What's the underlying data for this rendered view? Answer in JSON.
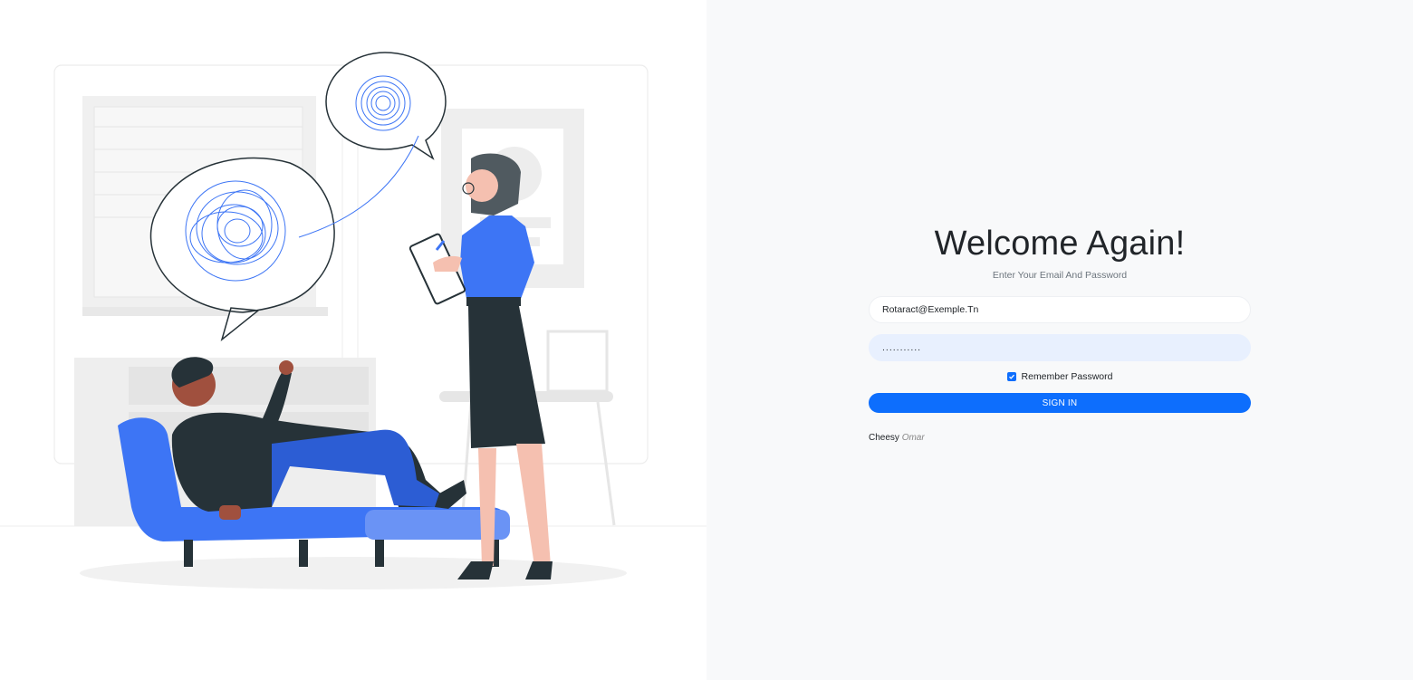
{
  "login": {
    "title": "Welcome Again!",
    "subtitle": "Enter Your Email And Password",
    "email_value": "Rotaract@Exemple.Tn",
    "password_value": "...........",
    "remember_label": "Remember Password",
    "remember_checked": true,
    "signin_label": "SIGN IN",
    "credit_first": "Cheesy",
    "credit_second": "Omar"
  },
  "colors": {
    "primary": "#0d6efd",
    "illustration_blue": "#3d75f5",
    "dark": "#263238",
    "right_bg": "#f8f9fa",
    "password_bg": "#e8f0fe"
  },
  "illustration": {
    "subject": "therapy-session-illustration"
  }
}
